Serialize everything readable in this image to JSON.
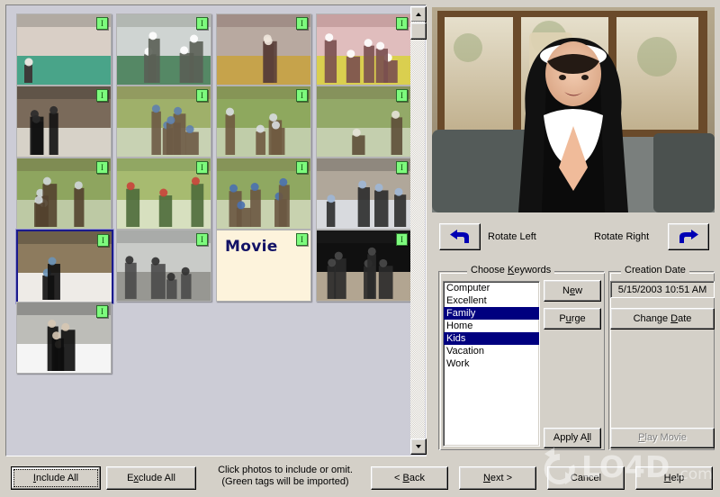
{
  "window": {
    "hint_line1": "Click photos to include or omit.",
    "hint_line2": "(Green tags will be imported)"
  },
  "thumbnails": {
    "tag_glyph": "I",
    "movie_label": "Movie",
    "items": [
      {
        "id": 1,
        "type": "photo",
        "tagged": true,
        "selected": false,
        "alt": "group of girls in green vests indoors"
      },
      {
        "id": 2,
        "type": "photo",
        "tagged": true,
        "selected": false,
        "alt": "snowy tree beside green deck railing"
      },
      {
        "id": 3,
        "type": "photo",
        "tagged": true,
        "selected": false,
        "alt": "children in costume at party"
      },
      {
        "id": 4,
        "type": "photo",
        "tagged": true,
        "selected": false,
        "alt": "kids posing against pink wall"
      },
      {
        "id": 5,
        "type": "photo",
        "tagged": true,
        "selected": false,
        "alt": "child in black nun costume by doorway"
      },
      {
        "id": 6,
        "type": "photo",
        "tagged": true,
        "selected": false,
        "alt": "girl climbing a birch tree"
      },
      {
        "id": 7,
        "type": "photo",
        "tagged": true,
        "selected": false,
        "alt": "children on lawn by stone wall"
      },
      {
        "id": 8,
        "type": "photo",
        "tagged": true,
        "selected": false,
        "alt": "man with bag on spring lawn"
      },
      {
        "id": 9,
        "type": "photo",
        "tagged": true,
        "selected": false,
        "alt": "family in yard with stone wall"
      },
      {
        "id": 10,
        "type": "photo",
        "tagged": true,
        "selected": false,
        "alt": "boy running on lawn"
      },
      {
        "id": 11,
        "type": "photo",
        "tagged": true,
        "selected": false,
        "alt": "children and dog on grass"
      },
      {
        "id": 12,
        "type": "photo",
        "tagged": true,
        "selected": false,
        "alt": "kids waving beside house"
      },
      {
        "id": 13,
        "type": "photo",
        "tagged": true,
        "selected": true,
        "alt": "child in nun costume praying"
      },
      {
        "id": 14,
        "type": "photo",
        "tagged": true,
        "selected": false,
        "alt": "desk and pole in grey room"
      },
      {
        "id": 15,
        "type": "movie",
        "tagged": true,
        "selected": false,
        "alt": "movie clip placeholder"
      },
      {
        "id": 16,
        "type": "photo",
        "tagged": true,
        "selected": false,
        "alt": "dark indoor party scene"
      },
      {
        "id": 17,
        "type": "photo",
        "tagged": true,
        "selected": false,
        "alt": "child in nun costume close up"
      }
    ]
  },
  "scrollbar": {
    "up_arrow": "scroll-up",
    "down_arrow": "scroll-down"
  },
  "preview": {
    "alt": "Child wearing a nun habit with hands pressed together in front of a sunlit window"
  },
  "rotate": {
    "left_label": "Rotate Left",
    "right_label": "Rotate Right"
  },
  "keywords": {
    "group_label": "Choose Keywords",
    "group_label_mnemonic": "K",
    "items": [
      {
        "label": "Computer",
        "selected": false
      },
      {
        "label": "Excellent",
        "selected": false
      },
      {
        "label": "Family",
        "selected": true
      },
      {
        "label": "Home",
        "selected": false
      },
      {
        "label": "Kids",
        "selected": true
      },
      {
        "label": "Vacation",
        "selected": false
      },
      {
        "label": "Work",
        "selected": false
      }
    ],
    "new_button": "New",
    "purge_button": "Purge",
    "apply_all_button": "Apply All"
  },
  "creation_date": {
    "group_label": "Creation Date",
    "value": "5/15/2003 10:51 AM",
    "change_button": "Change Date"
  },
  "play_movie": {
    "label": "Play Movie",
    "enabled": false
  },
  "buttons": {
    "include_all": "Include All",
    "exclude_all": "Exclude All",
    "back": "< Back",
    "next": "Next >",
    "cancel": "Cancel",
    "help": "Help"
  },
  "watermark": {
    "text": "LO4D.com"
  },
  "colors": {
    "window_face": "#d4d0c8",
    "panel_face": "#ccccd6",
    "selection_blue": "#00007f",
    "tag_green": "#7dfb7d",
    "movie_text": "#121266",
    "arrow_blue": "#0000b4"
  }
}
